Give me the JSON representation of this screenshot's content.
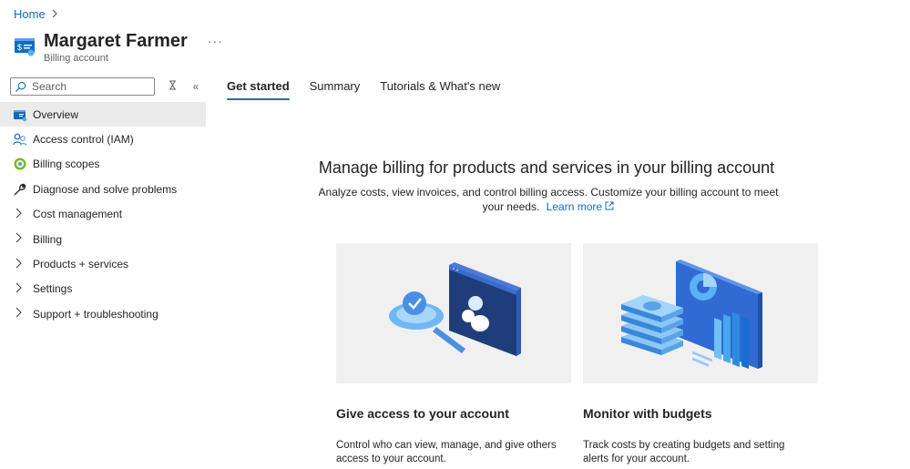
{
  "breadcrumb": {
    "home": "Home",
    "separator": ">"
  },
  "header": {
    "title": "Margaret Farmer",
    "subtitle": "Billing account",
    "more": "···"
  },
  "search": {
    "placeholder": "Search"
  },
  "sidebar_controls": {
    "clear": "x",
    "collapse": "«"
  },
  "sidebar": {
    "items": [
      {
        "label": "Overview",
        "icon": "billing-account-icon",
        "active": true
      },
      {
        "label": "Access control (IAM)",
        "icon": "people-icon"
      },
      {
        "label": "Billing scopes",
        "icon": "scope-icon"
      },
      {
        "label": "Diagnose and solve problems",
        "icon": "wrench-icon"
      },
      {
        "label": "Cost management",
        "icon": "chevron-right-icon"
      },
      {
        "label": "Billing",
        "icon": "chevron-right-icon"
      },
      {
        "label": "Products + services",
        "icon": "chevron-right-icon"
      },
      {
        "label": "Settings",
        "icon": "chevron-right-icon"
      },
      {
        "label": "Support + troubleshooting",
        "icon": "chevron-right-icon"
      }
    ]
  },
  "tabs": [
    {
      "label": "Get started",
      "active": true
    },
    {
      "label": "Summary"
    },
    {
      "label": "Tutorials & What's new"
    }
  ],
  "hero": {
    "title": "Manage billing for products and services in your billing account",
    "description": "Analyze costs, view invoices, and control billing access. Customize your billing account to meet your needs.",
    "learn_more": "Learn more"
  },
  "cards": [
    {
      "title": "Give access to your account",
      "description": "Control who can view, manage, and give others access to your account."
    },
    {
      "title": "Monitor with budgets",
      "description": "Track costs by creating budgets and setting alerts for your account."
    }
  ],
  "colors": {
    "accent": "#0f6cbd",
    "active_bg": "#ebebeb",
    "card_bg": "#f0f0f0"
  }
}
